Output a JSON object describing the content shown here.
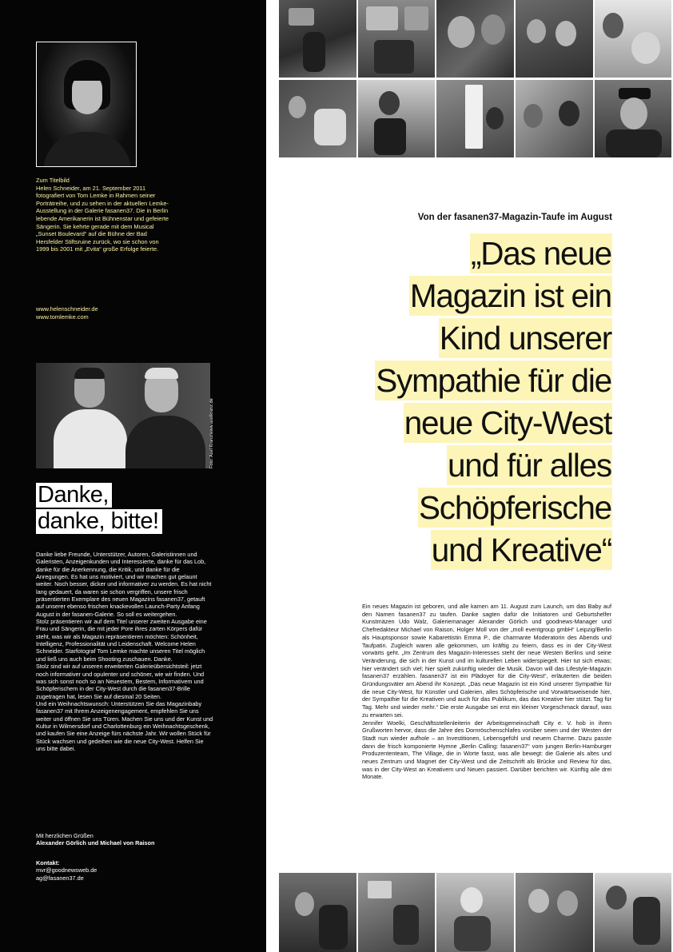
{
  "left": {
    "caption": {
      "title": "Zum Titelbild",
      "text": "Helen Schneider, am 21. September 2011 fotografiert von Tom Lemke in Rahmen seiner Porträtreihe, und zu sehen in der aktuellen Lemke-Ausstellung in der Galerie fasanen37. Die in Berlin lebende Amerikanerin ist Bühnenstar und gefeierte Sängerin. Sie kehrte gerade mit dem Musical „Sunset Boulevard“ auf die Bühne der Bad Hersfelder Stiftsruine zurück, wo sie schon von 1999 bis 2001 mit „Evita“ große Erfolge feierte."
    },
    "links": [
      "www.helenschneider.de",
      "www.tomlemke.com"
    ],
    "photo_credit": "Foto: Axel Kranz/www.axelkranz.de",
    "headline": [
      "Danke,",
      "danke, bitte!"
    ],
    "body": [
      "Danke liebe Freunde, Unterstützer, Autoren, Galeristinnen und Galeristen, Anzeigenkunden und Interessierte, danke für das Lob, danke für die Anerkennung, die Kritik, und danke für die Anregungen. Es hat uns motiviert, und wir machen gut gelaunt weiter. Noch besser, dicker und informativer zu werden. Es hat nicht lang gedauert, da waren sie schon vergriffen, unsere frisch präsentierten Exemplare des neuen Magazins fasanen37, getauft auf unserer ebenso frischen knackevollen Launch-Party Anfang August in der fasanen-Galerie. So soll es weitergehen.",
      "Stolz präsentieren wir auf dem Titel unserer zweiten Ausgabe eine Frau und Sängerin, die mit jeder Pore ihres zarten Körpers dafür steht, was wir als Magazin repräsentieren möchten: Schönheit, Intelligenz, Professionalität und Leidenschaft. Welcome Helen Schneider. Starfotograf Tom Lemke machte unseren Titel möglich und ließ uns auch beim Shooting zuschauen. Danke.",
      "Stolz sind wir auf unseren erweiterten Galerieübersichtsteil: jetzt noch informativer und opulenter und schöner, wie wir finden. Und was sich sonst noch so an Neuestem, Bestem, Informativem und Schöpferischem in der City-West durch die fasanen37-Brille zugetragen hat, lesen Sie auf diesmal 20 Seiten.",
      "Und ein Weihnachtswunsch: Unterstützen Sie das Magazinbaby fasanen37 mit Ihrem Anzeigenengagement, empfehlen Sie uns weiter und öffnen Sie uns Türen. Machen Sie uns und der Kunst und Kultur in Wilmersdorf und Charlottenburg ein Weihnachtsgeschenk, und kaufen Sie eine Anzeige fürs nächste Jahr. Wir wollen Stück für Stück wachsen und gedeihen wie die neue City-West. Helfen Sie uns bitte dabei."
    ],
    "sign": [
      "Mit herzlichen Grüßen",
      "Alexander Görlich und Michael von Raison"
    ],
    "contact": [
      "Kontakt:",
      "mvr@goodnewsweb.de",
      "ag@fasanen37.de"
    ]
  },
  "right": {
    "kicker": "Von der fasanen37-Magazin-Taufe im August",
    "headline": [
      "„Das neue",
      "Magazin ist ein",
      "Kind unserer",
      "Sympathie für die",
      "neue City-West",
      "und für alles",
      "Schöpferische",
      "und Kreative“"
    ],
    "body": [
      "Ein neues Magazin ist geboren, und alle kamen am 11. August zum Launch, um das Baby auf den Namen fasanen37 zu taufen. Danke sagten dafür die Initiatoren und Geburtshelfer Kunstmäzen Udo Walz, Galeriemanager Alexander Görlich und goodnews-Manager und Chefredakteur Michael von Raison, Holger Moll von der „moll eventgroup gmbH“ Leipzig/Berlin als Hauptsponsor sowie Kabarettistin Emma P., die charmante Moderatorin des Abends und Taufpatin. Zugleich waren alle gekommen, um kräftig zu feiern, dass es in der City-West vorwärts geht. „Im Zentrum des Magazin-Interesses steht der neue Westen Berlins und seine Veränderung, die sich in der Kunst und im kulturellen Leben widerspiegelt. Hier tut sich etwas; hier verändert sich viel; hier spielt zukünftig wieder die Musik. Davon will das Lifestyle-Magazin fasanen37 erzählen. fasanen37 ist ein Plädoyer für die City-West“, erläuterten die beiden Gründungsväter am Abend ihr Konzept. „Das neue Magazin ist ein Kind unserer Sympathie für die neue City-West, für Künstler und Galerien, alles Schöpferische und Vorwärtsweisende hier, der Sympathie für die Kreativen und auch für das Publikum, das das Kreative hier stützt. Tag für Tag. Mehr und wieder mehr.“ Die erste Ausgabe sei erst ein kleiner Vorgeschmack darauf, was zu erwarten sei.",
      "Jennifer Woelki, Geschäftsstellenleiterin der Arbeitsgemeinschaft City e. V. hob in ihren Grußworten hervor, dass die Jahre des Dornröschenschlafes vorüber seien und der Westen der Stadt nun wieder aufhole – an Investitionen, Lebensgefühl und neuem Charme. Dazu passte dann die frisch komponierte Hymne „Berlin Calling: fasanen37“ vom jungen Berlin-Hamburger Produzententeam, The Village, die in Worte fasst, was alle bewegt: die Galerie als altes und neues Zentrum und Magnet der City-West und die Zeitschrift als Brücke und Review für das, was in der City-West an Kreativem und Neuen passiert. Darüber berichten wir. Künftig alle drei Monate."
    ]
  }
}
